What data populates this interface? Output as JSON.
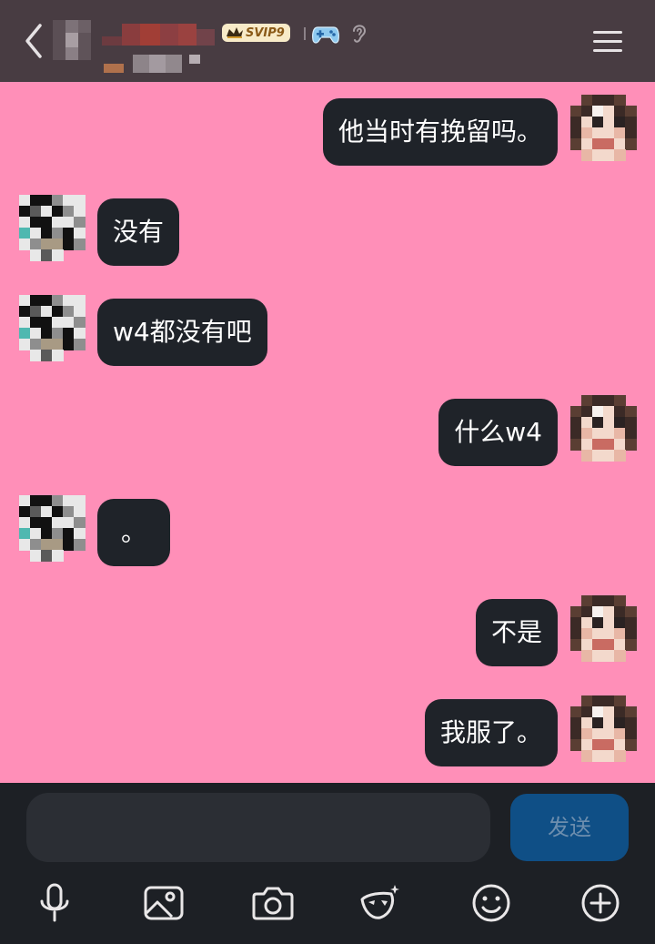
{
  "header": {
    "badge_text": "SVIP9",
    "icons": [
      "back-chevron-icon",
      "crown-icon",
      "gamepad-icon",
      "ear-icon",
      "menu-icon"
    ],
    "avatar_blurred": true,
    "name_blurred": true
  },
  "messages": [
    {
      "side": "right",
      "text": "他当时有挽留吗。"
    },
    {
      "side": "left",
      "text": "没有"
    },
    {
      "side": "left",
      "text": "w4都没有吧"
    },
    {
      "side": "right",
      "text": "什么w4"
    },
    {
      "side": "left",
      "text": "。"
    },
    {
      "side": "right",
      "text": "不是"
    },
    {
      "side": "right",
      "text": "我服了。"
    }
  ],
  "input": {
    "value": "",
    "send_label": "发送"
  },
  "toolbar": {
    "items": [
      "microphone-icon",
      "image-icon",
      "camera-icon",
      "mask-icon",
      "emoji-icon",
      "plus-icon"
    ]
  },
  "colors": {
    "header_bg": "#483c42",
    "chat_bg": "#ff8fb8",
    "bubble_bg": "#1f2329",
    "bar_bg": "#1d2025",
    "send_bg": "#0f4f86"
  }
}
